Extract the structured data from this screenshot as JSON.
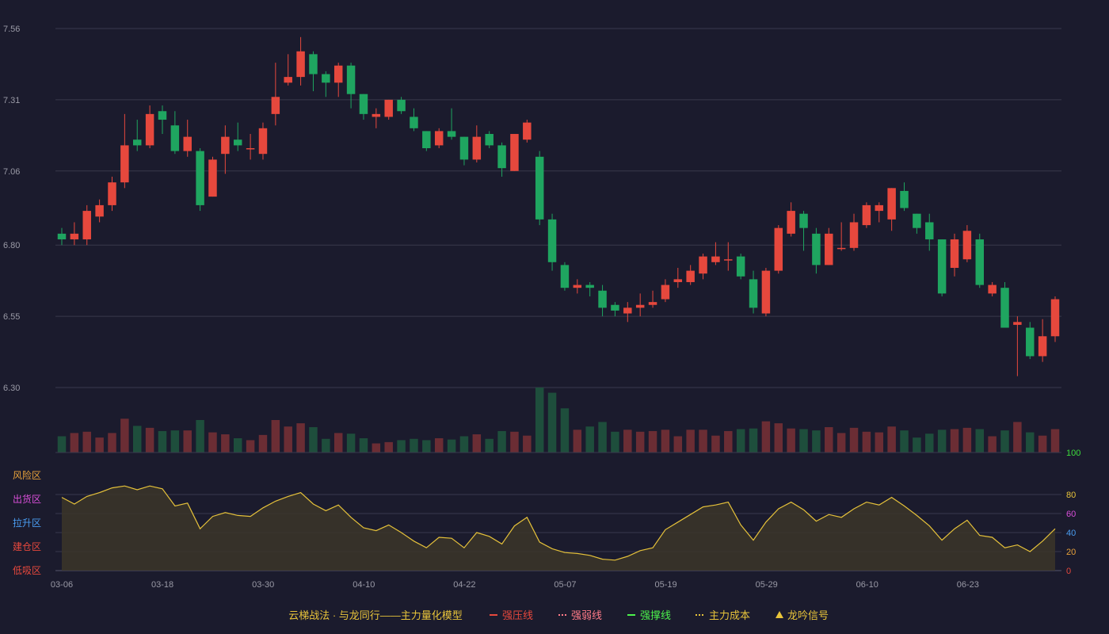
{
  "colors": {
    "background": "#1b1b2d",
    "up": "#e6483d",
    "down": "#1fa560",
    "vol_up": "#6b2d34",
    "vol_down": "#1e4e3c",
    "grid": "#3a3a4d",
    "oscillator_line": "#e5c13a",
    "oscillator_fill": "#3b3529",
    "axis_text": "#9a9aa6"
  },
  "chart_data": {
    "type": "candlestick",
    "price_axis": {
      "ticks": [
        "7.56",
        "7.31",
        "7.06",
        "6.80",
        "6.55",
        "6.30"
      ],
      "range": [
        6.3,
        7.56
      ]
    },
    "dates": [
      "03-06",
      "03-18",
      "03-30",
      "04-10",
      "04-22",
      "05-07",
      "05-19",
      "05-29",
      "06-10",
      "06-23"
    ],
    "candles": [
      [
        6.84,
        6.82,
        6.86,
        6.8
      ],
      [
        6.82,
        6.84,
        6.88,
        6.8
      ],
      [
        6.82,
        6.92,
        6.94,
        6.8
      ],
      [
        6.9,
        6.94,
        6.96,
        6.88
      ],
      [
        6.94,
        7.02,
        7.04,
        6.92
      ],
      [
        7.02,
        7.15,
        7.26,
        7.0
      ],
      [
        7.17,
        7.15,
        7.24,
        7.13
      ],
      [
        7.15,
        7.26,
        7.29,
        7.14
      ],
      [
        7.27,
        7.24,
        7.29,
        7.19
      ],
      [
        7.22,
        7.13,
        7.27,
        7.12
      ],
      [
        7.13,
        7.18,
        7.24,
        7.11
      ],
      [
        7.13,
        6.94,
        7.14,
        6.92
      ],
      [
        6.97,
        7.1,
        7.11,
        6.97
      ],
      [
        7.12,
        7.18,
        7.22,
        7.05
      ],
      [
        7.17,
        7.15,
        7.23,
        7.13
      ],
      [
        7.14,
        7.14,
        7.19,
        7.1
      ],
      [
        7.12,
        7.21,
        7.23,
        7.1
      ],
      [
        7.26,
        7.32,
        7.44,
        7.22
      ],
      [
        7.37,
        7.39,
        7.47,
        7.36
      ],
      [
        7.39,
        7.48,
        7.53,
        7.36
      ],
      [
        7.47,
        7.4,
        7.48,
        7.34
      ],
      [
        7.4,
        7.37,
        7.41,
        7.32
      ],
      [
        7.37,
        7.43,
        7.44,
        7.32
      ],
      [
        7.43,
        7.33,
        7.44,
        7.28
      ],
      [
        7.33,
        7.26,
        7.33,
        7.24
      ],
      [
        7.25,
        7.26,
        7.28,
        7.21
      ],
      [
        7.25,
        7.31,
        7.31,
        7.24
      ],
      [
        7.31,
        7.27,
        7.32,
        7.26
      ],
      [
        7.25,
        7.21,
        7.28,
        7.2
      ],
      [
        7.2,
        7.14,
        7.2,
        7.13
      ],
      [
        7.15,
        7.2,
        7.21,
        7.14
      ],
      [
        7.2,
        7.18,
        7.28,
        7.17
      ],
      [
        7.18,
        7.1,
        7.18,
        7.08
      ],
      [
        7.1,
        7.18,
        7.22,
        7.09
      ],
      [
        7.19,
        7.15,
        7.2,
        7.14
      ],
      [
        7.15,
        7.07,
        7.16,
        7.04
      ],
      [
        7.06,
        7.19,
        7.19,
        7.06
      ],
      [
        7.17,
        7.23,
        7.24,
        7.16
      ],
      [
        7.11,
        6.89,
        7.13,
        6.87
      ],
      [
        6.89,
        6.74,
        6.91,
        6.71
      ],
      [
        6.73,
        6.65,
        6.74,
        6.64
      ],
      [
        6.65,
        6.66,
        6.68,
        6.63
      ],
      [
        6.66,
        6.65,
        6.67,
        6.62
      ],
      [
        6.64,
        6.58,
        6.66,
        6.55
      ],
      [
        6.59,
        6.57,
        6.6,
        6.55
      ],
      [
        6.56,
        6.58,
        6.6,
        6.53
      ],
      [
        6.58,
        6.59,
        6.63,
        6.55
      ],
      [
        6.59,
        6.6,
        6.64,
        6.58
      ],
      [
        6.61,
        6.66,
        6.68,
        6.6
      ],
      [
        6.67,
        6.68,
        6.72,
        6.65
      ],
      [
        6.67,
        6.71,
        6.73,
        6.66
      ],
      [
        6.7,
        6.76,
        6.77,
        6.68
      ],
      [
        6.74,
        6.76,
        6.81,
        6.73
      ],
      [
        6.75,
        6.75,
        6.81,
        6.71
      ],
      [
        6.76,
        6.69,
        6.77,
        6.68
      ],
      [
        6.68,
        6.58,
        6.71,
        6.56
      ],
      [
        6.56,
        6.71,
        6.72,
        6.55
      ],
      [
        6.71,
        6.86,
        6.87,
        6.7
      ],
      [
        6.84,
        6.92,
        6.95,
        6.83
      ],
      [
        6.91,
        6.86,
        6.92,
        6.78
      ],
      [
        6.84,
        6.73,
        6.86,
        6.7
      ],
      [
        6.73,
        6.84,
        6.86,
        6.73
      ],
      [
        6.79,
        6.79,
        6.88,
        6.78
      ],
      [
        6.79,
        6.88,
        6.91,
        6.78
      ],
      [
        6.87,
        6.94,
        6.95,
        6.86
      ],
      [
        6.92,
        6.94,
        6.95,
        6.88
      ],
      [
        6.89,
        7.0,
        7.0,
        6.85
      ],
      [
        6.99,
        6.93,
        7.02,
        6.92
      ],
      [
        6.91,
        6.86,
        6.91,
        6.84
      ],
      [
        6.88,
        6.82,
        6.91,
        6.78
      ],
      [
        6.82,
        6.63,
        6.82,
        6.62
      ],
      [
        6.72,
        6.82,
        6.84,
        6.69
      ],
      [
        6.75,
        6.85,
        6.87,
        6.74
      ],
      [
        6.82,
        6.66,
        6.84,
        6.65
      ],
      [
        6.63,
        6.66,
        6.67,
        6.62
      ],
      [
        6.65,
        6.51,
        6.67,
        6.51
      ],
      [
        6.52,
        6.53,
        6.55,
        6.34
      ],
      [
        6.51,
        6.41,
        6.53,
        6.4
      ],
      [
        6.41,
        6.48,
        6.54,
        6.39
      ],
      [
        6.48,
        6.61,
        6.62,
        6.46
      ]
    ],
    "volume": [
      25,
      30,
      32,
      23,
      30,
      52,
      41,
      38,
      33,
      34,
      34,
      50,
      31,
      28,
      22,
      19,
      27,
      50,
      40,
      45,
      39,
      21,
      30,
      29,
      22,
      14,
      16,
      19,
      21,
      19,
      22,
      20,
      25,
      28,
      21,
      33,
      32,
      26,
      100,
      92,
      68,
      35,
      40,
      47,
      32,
      35,
      32,
      33,
      35,
      25,
      35,
      35,
      26,
      33,
      36,
      37,
      48,
      45,
      37,
      36,
      34,
      39,
      30,
      38,
      32,
      31,
      40,
      34,
      23,
      29,
      35,
      36,
      38,
      36,
      25,
      34,
      47,
      31,
      26,
      36
    ],
    "oscillator": {
      "axis_ticks": [
        "100",
        "80",
        "60",
        "40",
        "20",
        "0"
      ],
      "zones": [
        "风险区",
        "出货区",
        "拉升区",
        "建仓区",
        "低吸区"
      ],
      "values": [
        77,
        70,
        78,
        82,
        87,
        89,
        85,
        89,
        86,
        68,
        71,
        44,
        57,
        61,
        58,
        57,
        66,
        73,
        78,
        82,
        70,
        63,
        69,
        56,
        45,
        42,
        48,
        40,
        31,
        24,
        35,
        34,
        24,
        40,
        36,
        28,
        47,
        56,
        30,
        23,
        19,
        18,
        16,
        12,
        11,
        15,
        21,
        24,
        43,
        51,
        59,
        67,
        69,
        72,
        48,
        32,
        51,
        65,
        72,
        64,
        52,
        59,
        56,
        65,
        72,
        69,
        77,
        68,
        58,
        47,
        32,
        44,
        53,
        37,
        35,
        24,
        27,
        20,
        31,
        44
      ]
    },
    "legend": {
      "title": "云梯战法 · 与龙同行——主力量化模型",
      "items": [
        "强压线",
        "强弱线",
        "强撑线",
        "主力成本",
        "龙吟信号"
      ]
    }
  }
}
